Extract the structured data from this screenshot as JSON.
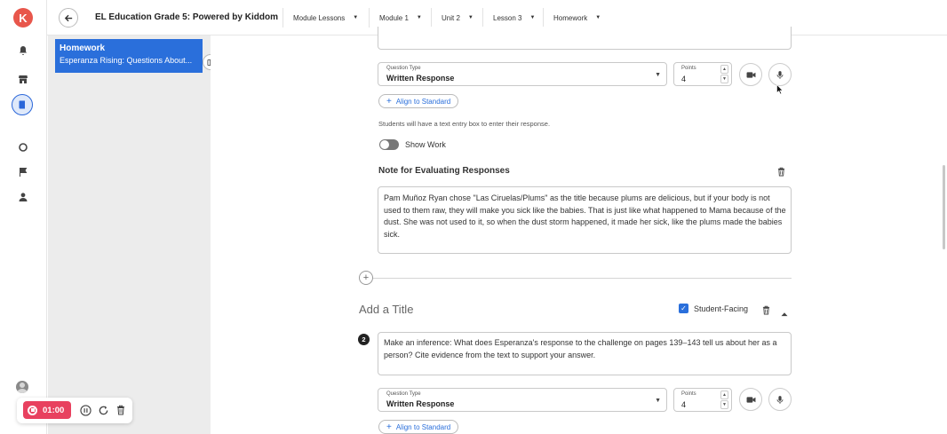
{
  "topbar": {
    "course_title": "EL Education Grade 5: Powered by Kiddom",
    "breadcrumbs": [
      "Module Lessons",
      "Module 1",
      "Unit 2",
      "Lesson 3",
      "Homework"
    ]
  },
  "sidebar": {
    "card_title": "Homework",
    "card_subtitle": "Esperanza Rising: Questions About..."
  },
  "question1": {
    "question_type_label": "Question Type",
    "question_type_value": "Written Response",
    "points_label": "Points",
    "points_value": "4",
    "align_label": "Align to Standard",
    "helper_text": "Students will have a text entry box to enter their response.",
    "show_work_label": "Show Work",
    "note_heading": "Note for Evaluating Responses",
    "note_text": "Pam Muñoz Ryan chose \"Las Ciruelas/Plums\" as the title because plums are delicious, but if your body is not used to them raw, they will make you sick like the babies. That is just like what happened to Mama because of the dust. She was not used to it, so when the dust storm happened, it made her sick, like the plums made the babies sick."
  },
  "question2": {
    "title_placeholder": "Add a Title",
    "student_facing_label": "Student-Facing",
    "number": "2",
    "prompt": "Make an inference: What does Esperanza's response to the challenge on pages 139–143 tell us about her as a person? Cite evidence from the text to support your answer.",
    "question_type_label": "Question Type",
    "question_type_value": "Written Response",
    "points_label": "Points",
    "points_value": "4",
    "align_label": "Align to Standard"
  },
  "recorder": {
    "time": "01:00"
  },
  "colors": {
    "accent": "#2a6fdb",
    "brand": "#e8564b",
    "record": "#e8415f"
  }
}
